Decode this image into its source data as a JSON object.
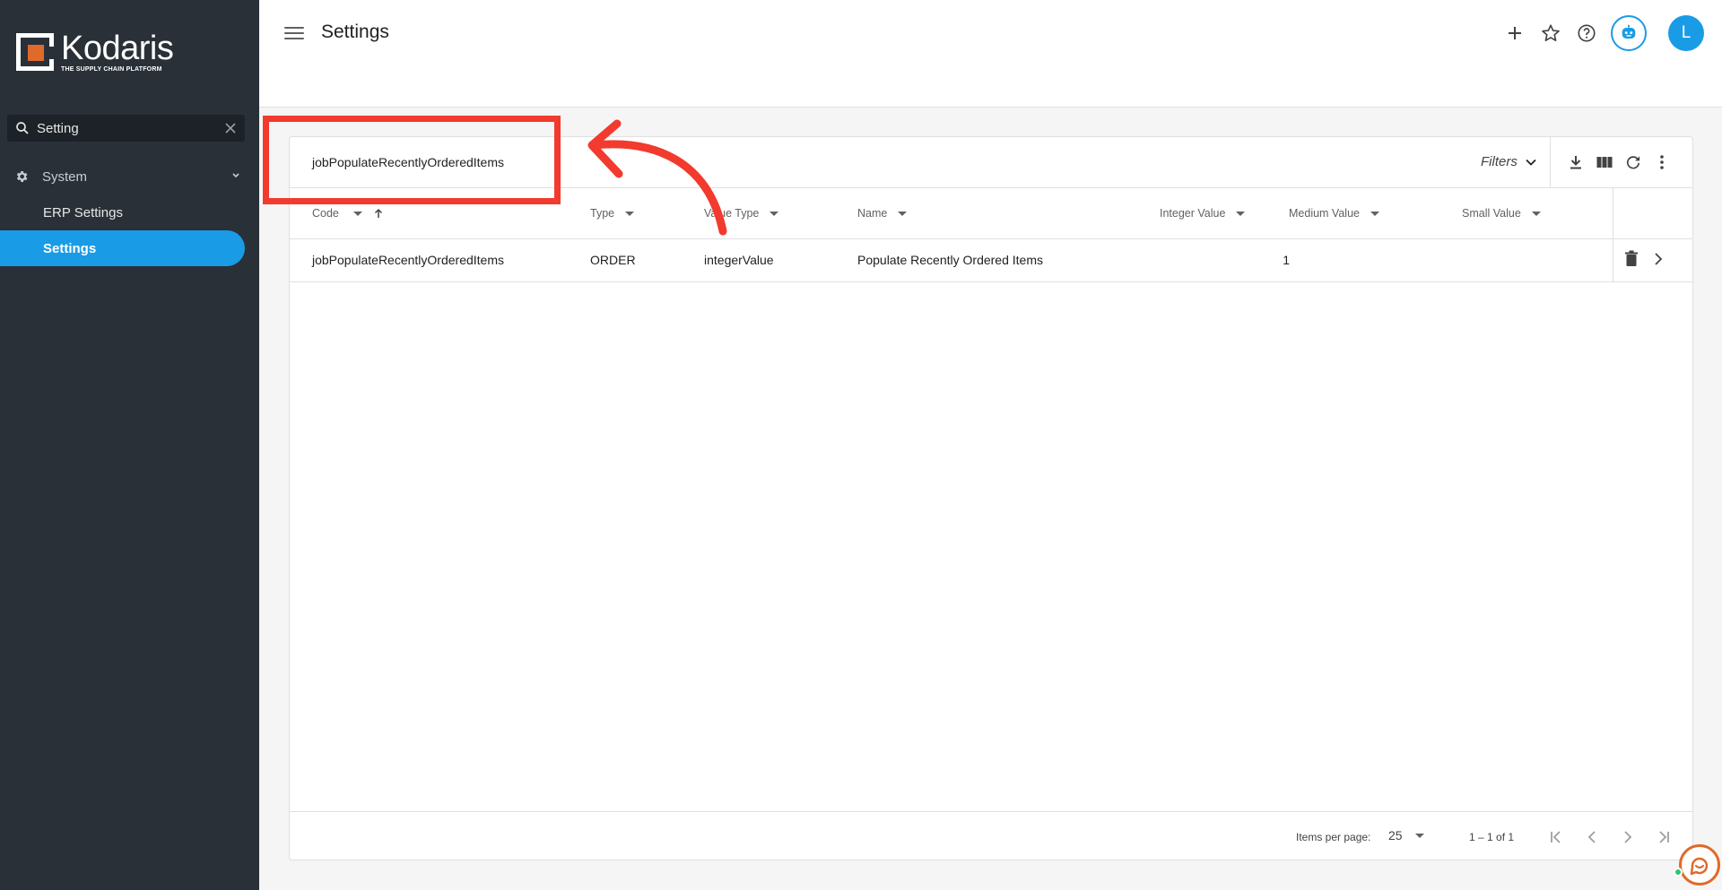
{
  "brand": {
    "name": "Kodaris",
    "tagline": "THE SUPPLY CHAIN PLATFORM"
  },
  "sidebar": {
    "search": {
      "value": "Setting",
      "placeholder": "Search"
    },
    "group": {
      "label": "System"
    },
    "items": [
      {
        "label": "ERP Settings",
        "active": false
      },
      {
        "label": "Settings",
        "active": true
      }
    ]
  },
  "header": {
    "title": "Settings",
    "avatar_initial": "L"
  },
  "toolbar": {
    "search_value": "jobPopulateRecentlyOrderedItems",
    "filters_label": "Filters"
  },
  "table": {
    "columns": [
      "Code",
      "Type",
      "Value Type",
      "Name",
      "Integer Value",
      "Medium Value",
      "Small Value"
    ],
    "rows": [
      {
        "code": "jobPopulateRecentlyOrderedItems",
        "type": "ORDER",
        "value_type": "integerValue",
        "name": "Populate Recently Ordered Items",
        "integer_value": "1",
        "medium_value": "",
        "small_value": ""
      }
    ]
  },
  "pagination": {
    "items_per_page_label": "Items per page:",
    "items_per_page": "25",
    "range": "1 – 1 of 1"
  },
  "colors": {
    "accent": "#1a9be6",
    "sidebar": "#293038",
    "annotation": "#f23a2e",
    "brand_orange": "#e06a2b"
  }
}
